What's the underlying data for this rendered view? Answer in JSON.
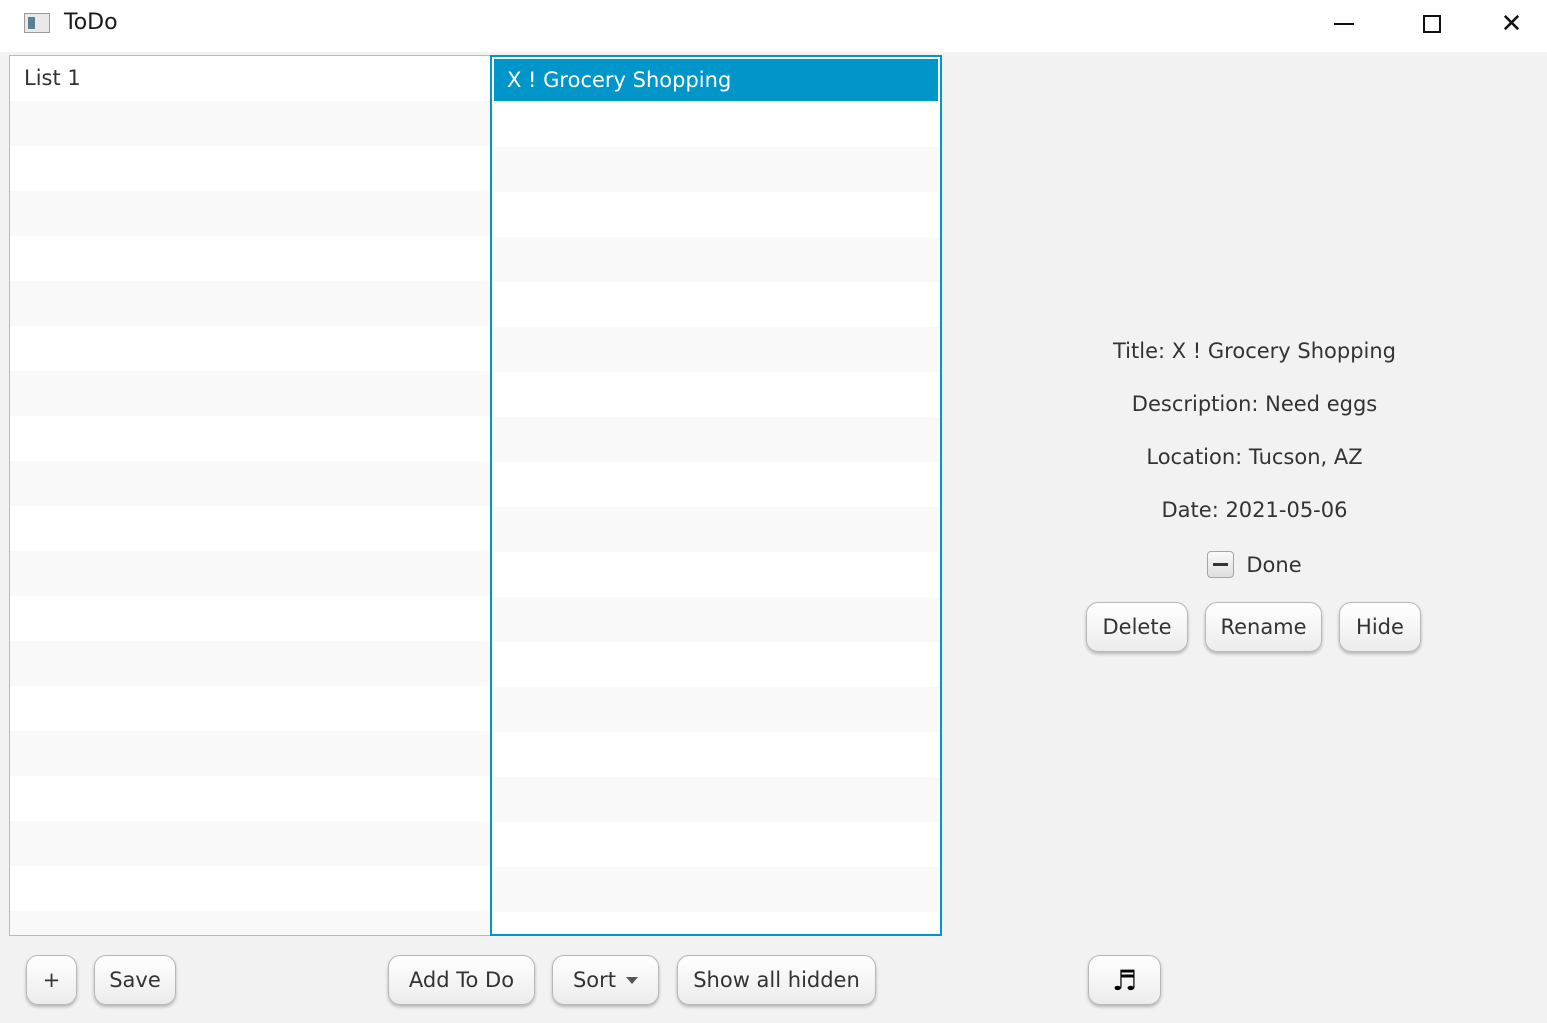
{
  "window": {
    "title": "ToDo",
    "minimize_icon": "minimize-icon",
    "maximize_icon": "maximize-icon",
    "close_icon": "close-icon",
    "close_glyph": "✕"
  },
  "lists_panel": {
    "items": [
      {
        "label": "List 1"
      }
    ]
  },
  "todos_panel": {
    "items": [
      {
        "label": "X ! Grocery Shopping",
        "selected": true
      }
    ],
    "accent_color": "#0096c9"
  },
  "detail": {
    "title": "Title: X ! Grocery Shopping",
    "description": "Description: Need eggs",
    "location": "Location: Tucson, AZ",
    "date": "Date: 2021-05-06",
    "done_label": "Done",
    "done_state": "indeterminate",
    "buttons": {
      "delete": "Delete",
      "rename": "Rename",
      "hide": "Hide"
    }
  },
  "toolbar": {
    "add_list": "+",
    "save": "Save",
    "add_todo": "Add To Do",
    "sort": "Sort",
    "show_hidden": "Show all hidden",
    "music_icon": "music-note-icon",
    "music_glyph": "♬"
  }
}
